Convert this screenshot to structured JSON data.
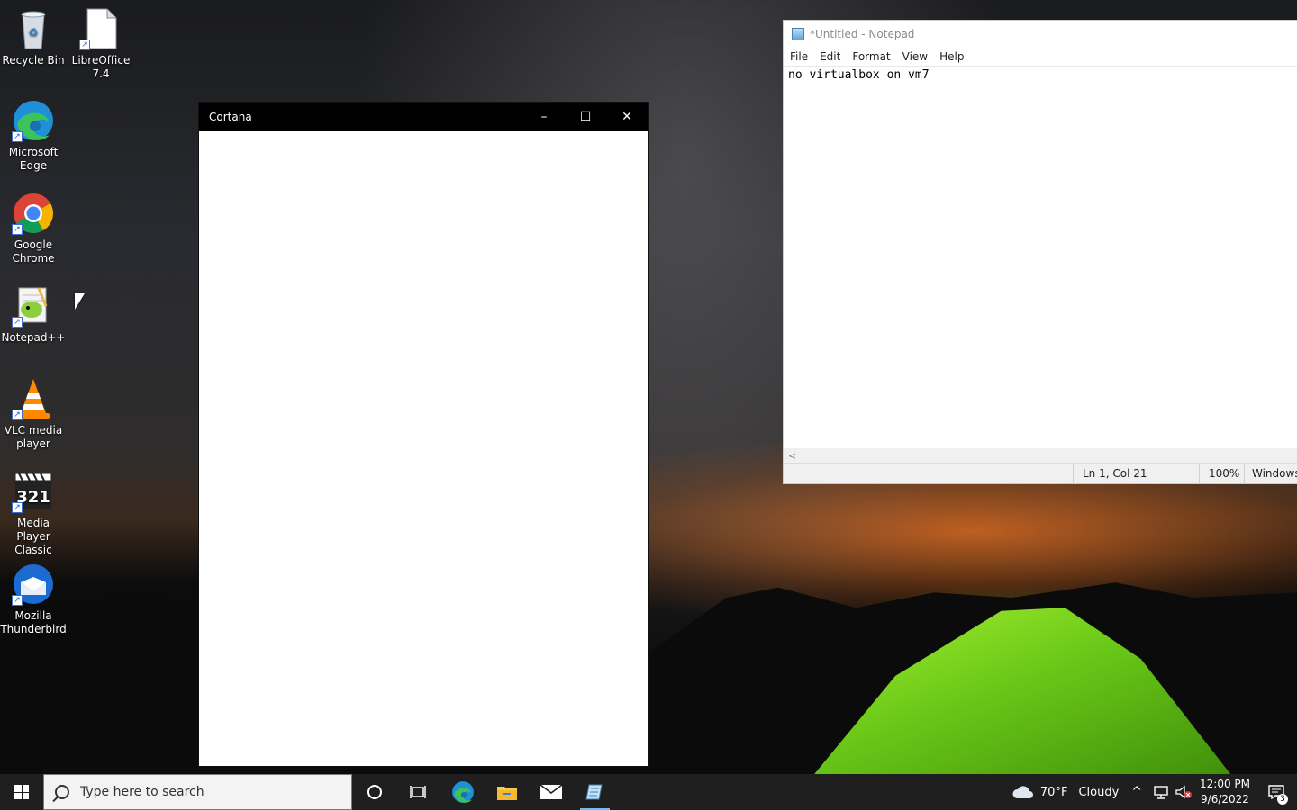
{
  "desktop": {
    "icons": [
      {
        "label": "Recycle Bin"
      },
      {
        "label": "LibreOffice 7.4"
      },
      {
        "label": "Microsoft Edge"
      },
      {
        "label": "Google Chrome"
      },
      {
        "label": "Notepad++"
      },
      {
        "label": "VLC media player"
      },
      {
        "label": "Media Player Classic"
      },
      {
        "label": "Mozilla Thunderbird"
      }
    ]
  },
  "cortana": {
    "title": "Cortana",
    "minimize": "–",
    "maximize": "☐",
    "close": "✕"
  },
  "notepad": {
    "title": "*Untitled - Notepad",
    "menu": [
      "File",
      "Edit",
      "Format",
      "View",
      "Help"
    ],
    "content": "no virtualbox on vm7",
    "scroll_left": "<",
    "status": {
      "position": "Ln 1, Col 21",
      "zoom": "100%",
      "line_endings": "Windows"
    }
  },
  "taskbar": {
    "search_placeholder": "Type here to search",
    "weather": {
      "temp": "70°F",
      "condition": "Cloudy"
    },
    "chevron": "^",
    "clock": {
      "time": "12:00 PM",
      "date": "9/6/2022"
    },
    "notifications_count": "3"
  }
}
